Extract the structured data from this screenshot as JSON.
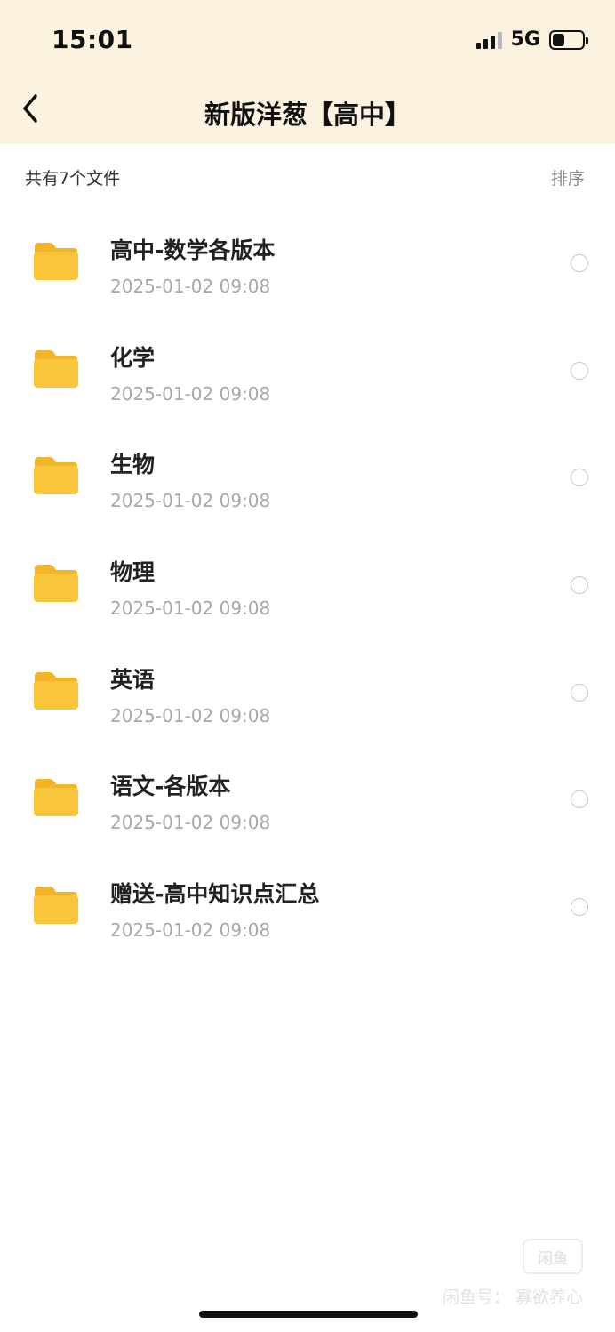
{
  "status_bar": {
    "time": "15:01",
    "network": "5G",
    "signal_bars_active": 3,
    "battery_level": 0.4
  },
  "nav": {
    "back_icon": "chevron-left-icon",
    "title": "新版洋葱【高中】"
  },
  "summary": {
    "count_text": "共有7个文件",
    "sort_label": "排序"
  },
  "files": [
    {
      "name": "高中-数学各版本",
      "date": "2025-01-02 09:08"
    },
    {
      "name": "化学",
      "date": "2025-01-02 09:08"
    },
    {
      "name": "生物",
      "date": "2025-01-02 09:08"
    },
    {
      "name": "物理",
      "date": "2025-01-02 09:08"
    },
    {
      "name": "英语",
      "date": "2025-01-02 09:08"
    },
    {
      "name": "语文-各版本",
      "date": "2025-01-02 09:08"
    },
    {
      "name": "赠送-高中知识点汇总",
      "date": "2025-01-02 09:08"
    }
  ],
  "watermark": {
    "logo_text": "闲鱼",
    "text": "闲鱼号： 寡欲养心"
  },
  "colors": {
    "header_bg": "#fbf3df",
    "folder": "#f9c53a"
  }
}
